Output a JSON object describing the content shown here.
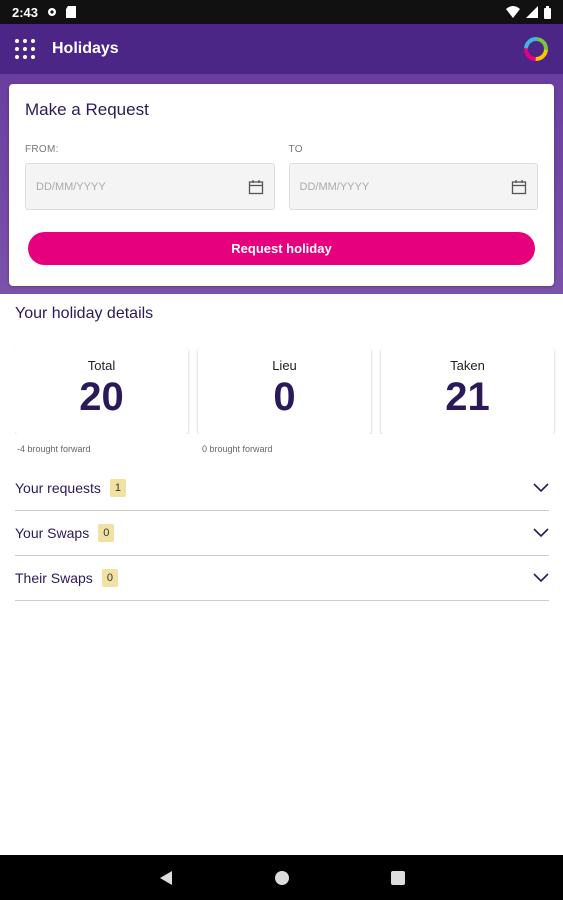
{
  "status": {
    "time": "2:43"
  },
  "app_bar": {
    "title": "Holidays"
  },
  "request": {
    "title": "Make a Request",
    "from_label": "FROM:",
    "from_placeholder": "DD/MM/YYYY",
    "to_label": "TO",
    "to_placeholder": "DD/MM/YYYY",
    "button_label": "Request holiday"
  },
  "details": {
    "title": "Your holiday details",
    "cards": [
      {
        "label": "Total",
        "value": "20"
      },
      {
        "label": "Lieu",
        "value": "0"
      },
      {
        "label": "Taken",
        "value": "21"
      }
    ],
    "notes": [
      "-4 brought forward",
      "0 brought forward"
    ]
  },
  "sections": [
    {
      "label": "Your requests",
      "count": "1"
    },
    {
      "label": "Your Swaps",
      "count": "0"
    },
    {
      "label": "Their Swaps",
      "count": "0"
    }
  ],
  "colors": {
    "primary": "#4b2686",
    "accent": "#e6007e",
    "badge": "#f0e2a2",
    "text_dark": "#2b1a5a"
  }
}
